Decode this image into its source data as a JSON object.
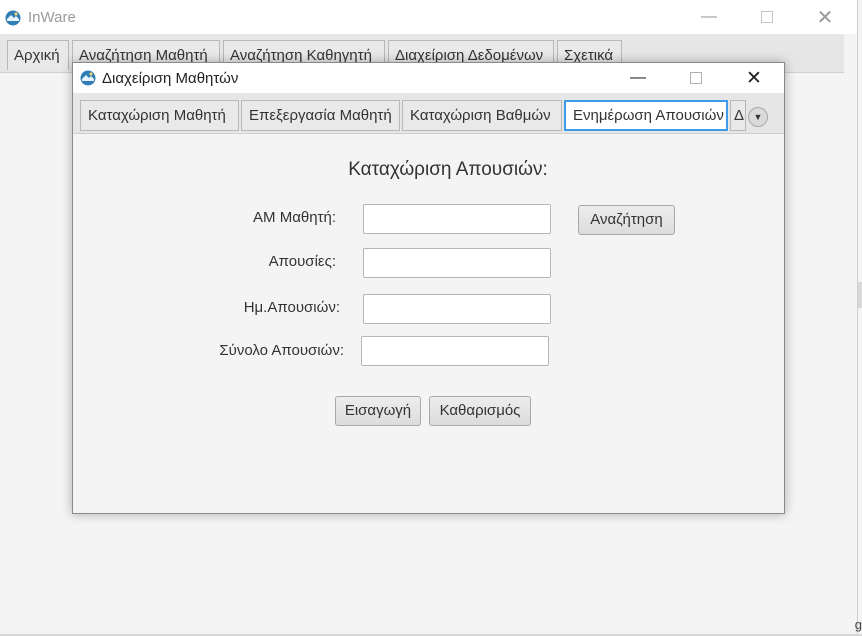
{
  "app": {
    "title": "InWare",
    "tabs": [
      {
        "label": "Αρχική"
      },
      {
        "label": "Αναζήτηση Μαθητή"
      },
      {
        "label": "Αναζήτηση Καθηγητή"
      },
      {
        "label": "Διαχείριση Δεδομένων"
      },
      {
        "label": "Σχετικά"
      }
    ]
  },
  "dialog": {
    "title": "Διαχείριση Μαθητών",
    "tabs": [
      {
        "label": "Καταχώριση Μαθητή"
      },
      {
        "label": "Επεξεργασία Μαθητή"
      },
      {
        "label": "Καταχώριση Βαθμών"
      },
      {
        "label": "Ενημέρωση Απουσιών"
      },
      {
        "label": "Δ"
      }
    ],
    "active_tab": "Ενημέρωση Απουσιών"
  },
  "form": {
    "title": "Καταχώριση Απουσιών:",
    "student_id_label": "ΑΜ Μαθητή:",
    "student_id_value": "",
    "absences_label": "Απουσίες:",
    "absences_value": "",
    "absence_date_label": "Ημ.Απουσιών:",
    "absence_date_value": "",
    "total_absences_label": "Σύνολο Απουσιών:",
    "total_absences_value": "",
    "search_button": "Αναζήτηση",
    "insert_button": "Εισαγωγή",
    "clear_button": "Καθαρισμός"
  },
  "edge_text": "g",
  "icons": {
    "app": "inware-logo-icon",
    "minimize": "minimize-icon",
    "maximize": "maximize-icon",
    "close": "close-icon",
    "overflow": "chevron-down-icon"
  },
  "colors": {
    "active_tab_border": "#3d9be9",
    "logo_blue": "#2f7fb6"
  }
}
